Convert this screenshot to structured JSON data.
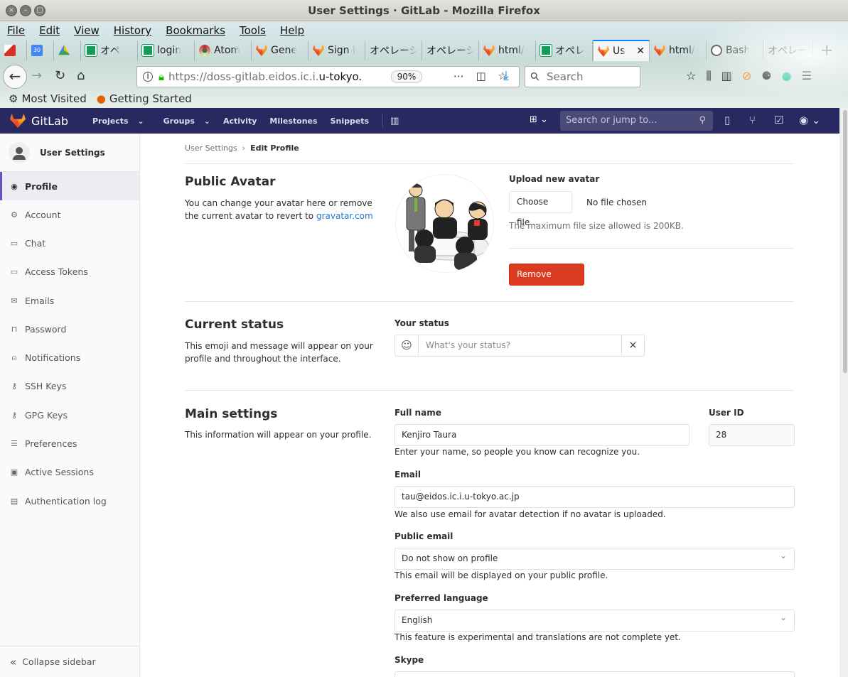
{
  "window": {
    "title": "User Settings · GitLab - Mozilla Firefox"
  },
  "menu": [
    "File",
    "Edit",
    "View",
    "History",
    "Bookmarks",
    "Tools",
    "Help"
  ],
  "tabs": [
    {
      "label": "オペ",
      "icon": "sheets-icon"
    },
    {
      "label": "login",
      "icon": "sheets-icon"
    },
    {
      "label": "Atom",
      "icon": "atom-icon"
    },
    {
      "label": "Gene",
      "icon": "gitlab-icon"
    },
    {
      "label": "Sign i",
      "icon": "gitlab-icon"
    },
    {
      "label": "オペレーシ",
      "icon": ""
    },
    {
      "label": "オペレーシ",
      "icon": ""
    },
    {
      "label": "html/",
      "icon": "gitlab-icon"
    },
    {
      "label": "オペレ",
      "icon": "sheets-icon"
    },
    {
      "label": "Us",
      "icon": "gitlab-icon",
      "active": true
    },
    {
      "label": "html/",
      "icon": "gitlab-icon"
    },
    {
      "label": "Bash",
      "icon": "info-icon"
    },
    {
      "label": "オペレーシ",
      "icon": ""
    }
  ],
  "pinned_tabs": [
    "gmail",
    "calendar",
    "drive"
  ],
  "calendar_day": "30",
  "url": {
    "prefix": "https://doss-gitlab.eidos.ic.i.",
    "highlight": "u-tokyo.ac.",
    "zoom": "90%"
  },
  "search": {
    "placeholder": "Search"
  },
  "bookmarks": [
    "Most Visited",
    "Getting Started"
  ],
  "gitlab": {
    "brand": "GitLab",
    "nav": [
      "Projects",
      "Groups",
      "Activity",
      "Milestones",
      "Snippets"
    ],
    "search_placeholder": "Search or jump to..."
  },
  "sidebar": {
    "title": "User Settings",
    "items": [
      {
        "label": "Profile",
        "icon": "profile-icon",
        "active": true
      },
      {
        "label": "Account",
        "icon": "account-icon"
      },
      {
        "label": "Chat",
        "icon": "chat-icon"
      },
      {
        "label": "Access Tokens",
        "icon": "token-icon"
      },
      {
        "label": "Emails",
        "icon": "email-icon"
      },
      {
        "label": "Password",
        "icon": "lock-icon"
      },
      {
        "label": "Notifications",
        "icon": "bell-icon"
      },
      {
        "label": "SSH Keys",
        "icon": "key-icon"
      },
      {
        "label": "GPG Keys",
        "icon": "key-icon"
      },
      {
        "label": "Preferences",
        "icon": "sliders-icon"
      },
      {
        "label": "Active Sessions",
        "icon": "monitor-icon"
      },
      {
        "label": "Authentication log",
        "icon": "log-icon"
      }
    ],
    "collapse": "Collapse sidebar"
  },
  "breadcrumb": {
    "parent": "User Settings",
    "current": "Edit Profile"
  },
  "avatar_section": {
    "title": "Public Avatar",
    "desc": "You can change your avatar here or remove the current avatar to revert to",
    "link": "gravatar.com",
    "upload_label": "Upload new avatar",
    "choose_button": "Choose file...",
    "no_file": "No file chosen",
    "max_size": "The maximum file size allowed is 200KB.",
    "remove_button": "Remove avatar"
  },
  "status_section": {
    "title": "Current status",
    "desc": "This emoji and message will appear on your profile and throughout the interface.",
    "label": "Your status",
    "placeholder": "What's your status?"
  },
  "main_section": {
    "title": "Main settings",
    "desc": "This information will appear on your profile.",
    "full_name_label": "Full name",
    "full_name": "Kenjiro Taura",
    "full_name_help": "Enter your name, so people you know can recognize you.",
    "user_id_label": "User ID",
    "user_id": "28",
    "email_label": "Email",
    "email": "tau@eidos.ic.i.u-tokyo.ac.jp",
    "email_help": "We also use email for avatar detection if no avatar is uploaded.",
    "public_email_label": "Public email",
    "public_email": "Do not show on profile",
    "public_email_help": "This email will be displayed on your public profile.",
    "language_label": "Preferred language",
    "language": "English",
    "language_help": "This feature is experimental and translations are not complete yet.",
    "skype_label": "Skype"
  },
  "colors": {
    "gitlab_nav": "#292961",
    "danger": "#db3b21",
    "link": "#1f78d1",
    "active_border": "#6b4fbb"
  }
}
